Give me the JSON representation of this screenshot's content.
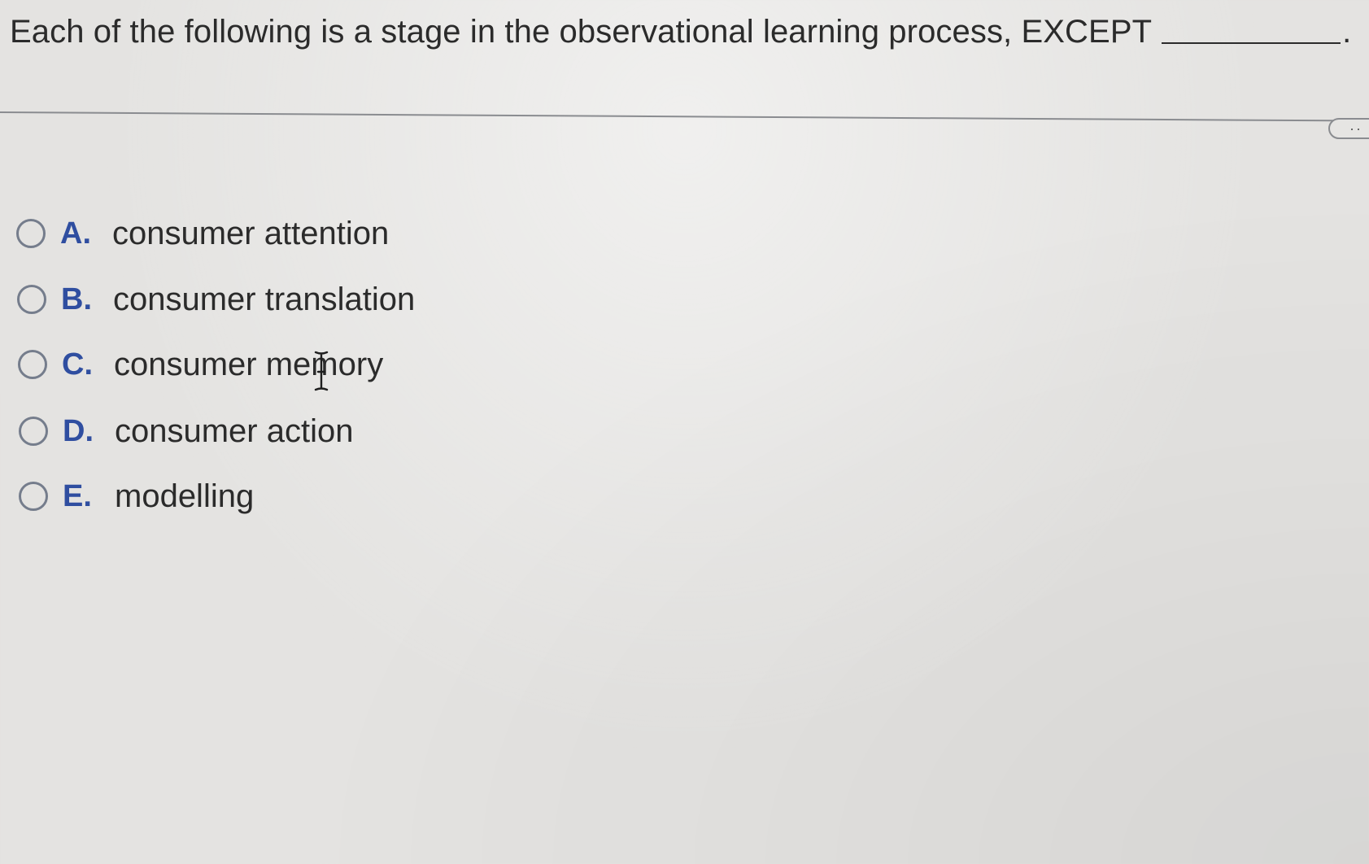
{
  "question": {
    "text": "Each of the following is a stage in the observational learning process, EXCEPT",
    "trailing": "."
  },
  "options": [
    {
      "letter": "A.",
      "text": "consumer attention",
      "selected": false
    },
    {
      "letter": "B.",
      "text": "consumer translation",
      "selected": false
    },
    {
      "letter": "C.",
      "text": "consumer memory",
      "selected": false
    },
    {
      "letter": "D.",
      "text": "consumer action",
      "selected": false
    },
    {
      "letter": "E.",
      "text": "modelling",
      "selected": false
    }
  ],
  "more_button": {
    "label": "··"
  },
  "colors": {
    "letter": "#2f4ea0",
    "radio_border": "#757d8c",
    "text": "#2b2b2b"
  },
  "cursor": "i-beam-cursor-icon"
}
